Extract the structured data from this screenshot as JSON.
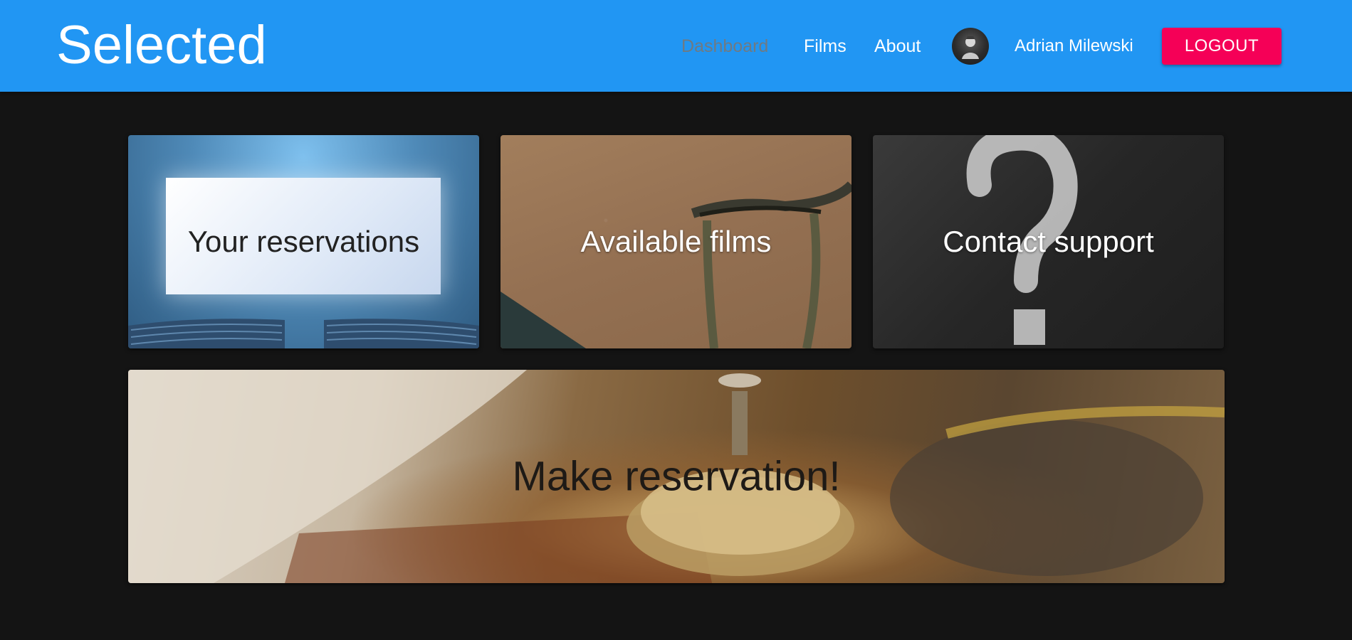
{
  "header": {
    "brand": "Selected",
    "nav": {
      "dashboard": "Dashboard",
      "films": "Films",
      "about": "About"
    },
    "user": {
      "name": "Adrian Milewski",
      "avatar_icon": "user-avatar"
    },
    "logout_label": "LOGOUT"
  },
  "cards": {
    "reservations": "Your reservations",
    "films": "Available films",
    "support": "Contact support",
    "make_reservation": "Make reservation!"
  },
  "colors": {
    "navbar": "#2196f3",
    "logout": "#f50057",
    "background": "#141414"
  }
}
